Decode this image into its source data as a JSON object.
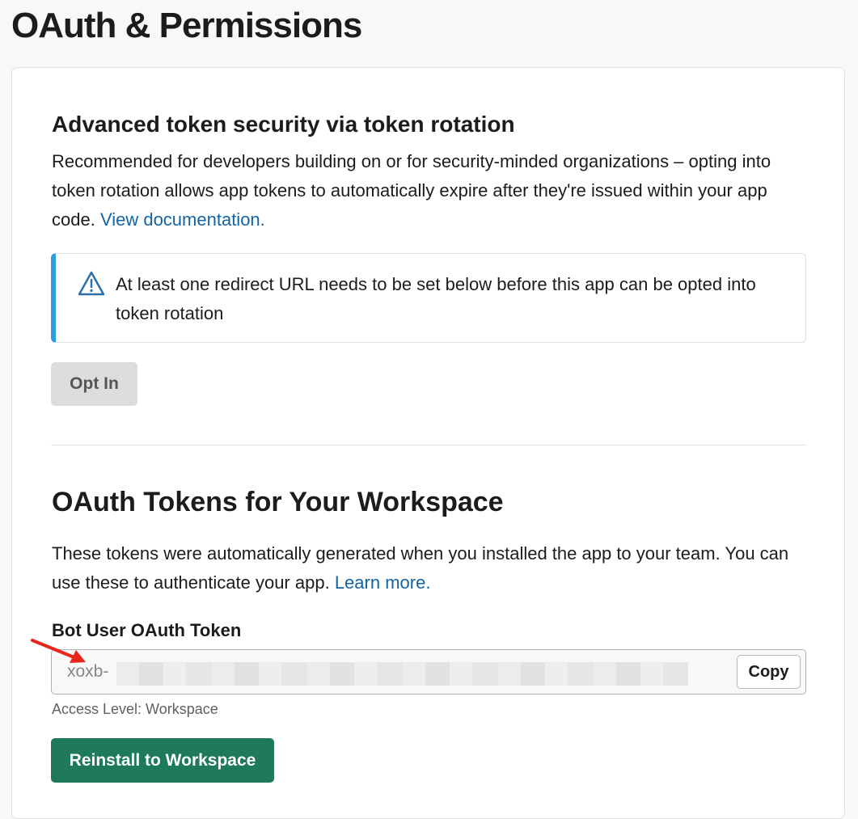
{
  "page": {
    "title": "OAuth & Permissions"
  },
  "token_rotation": {
    "title": "Advanced token security via token rotation",
    "description": "Recommended for developers building on or for security-minded organizations – opting into token rotation allows app tokens to automatically expire after they're issued within your app code. ",
    "doc_link": "View documentation.",
    "alert_text": "At least one redirect URL needs to be set below before this app can be opted into token rotation",
    "opt_in_label": "Opt In"
  },
  "oauth_tokens": {
    "title": "OAuth Tokens for Your Workspace",
    "description": "These tokens were automatically generated when you installed the app to your team. You can use these to authenticate your app. ",
    "learn_more": "Learn more.",
    "bot_token_label": "Bot User OAuth Token",
    "token_prefix": "xoxb-",
    "copy_label": "Copy",
    "access_level": "Access Level: Workspace",
    "reinstall_label": "Reinstall to Workspace"
  },
  "colors": {
    "alert_accent": "#2d9de0",
    "link": "#1264a3",
    "primary_button": "#1f7a5c",
    "annotation_arrow": "#e8241b"
  },
  "icons": {
    "alert": "warning-triangle-icon",
    "annotation": "red-arrow-icon"
  }
}
